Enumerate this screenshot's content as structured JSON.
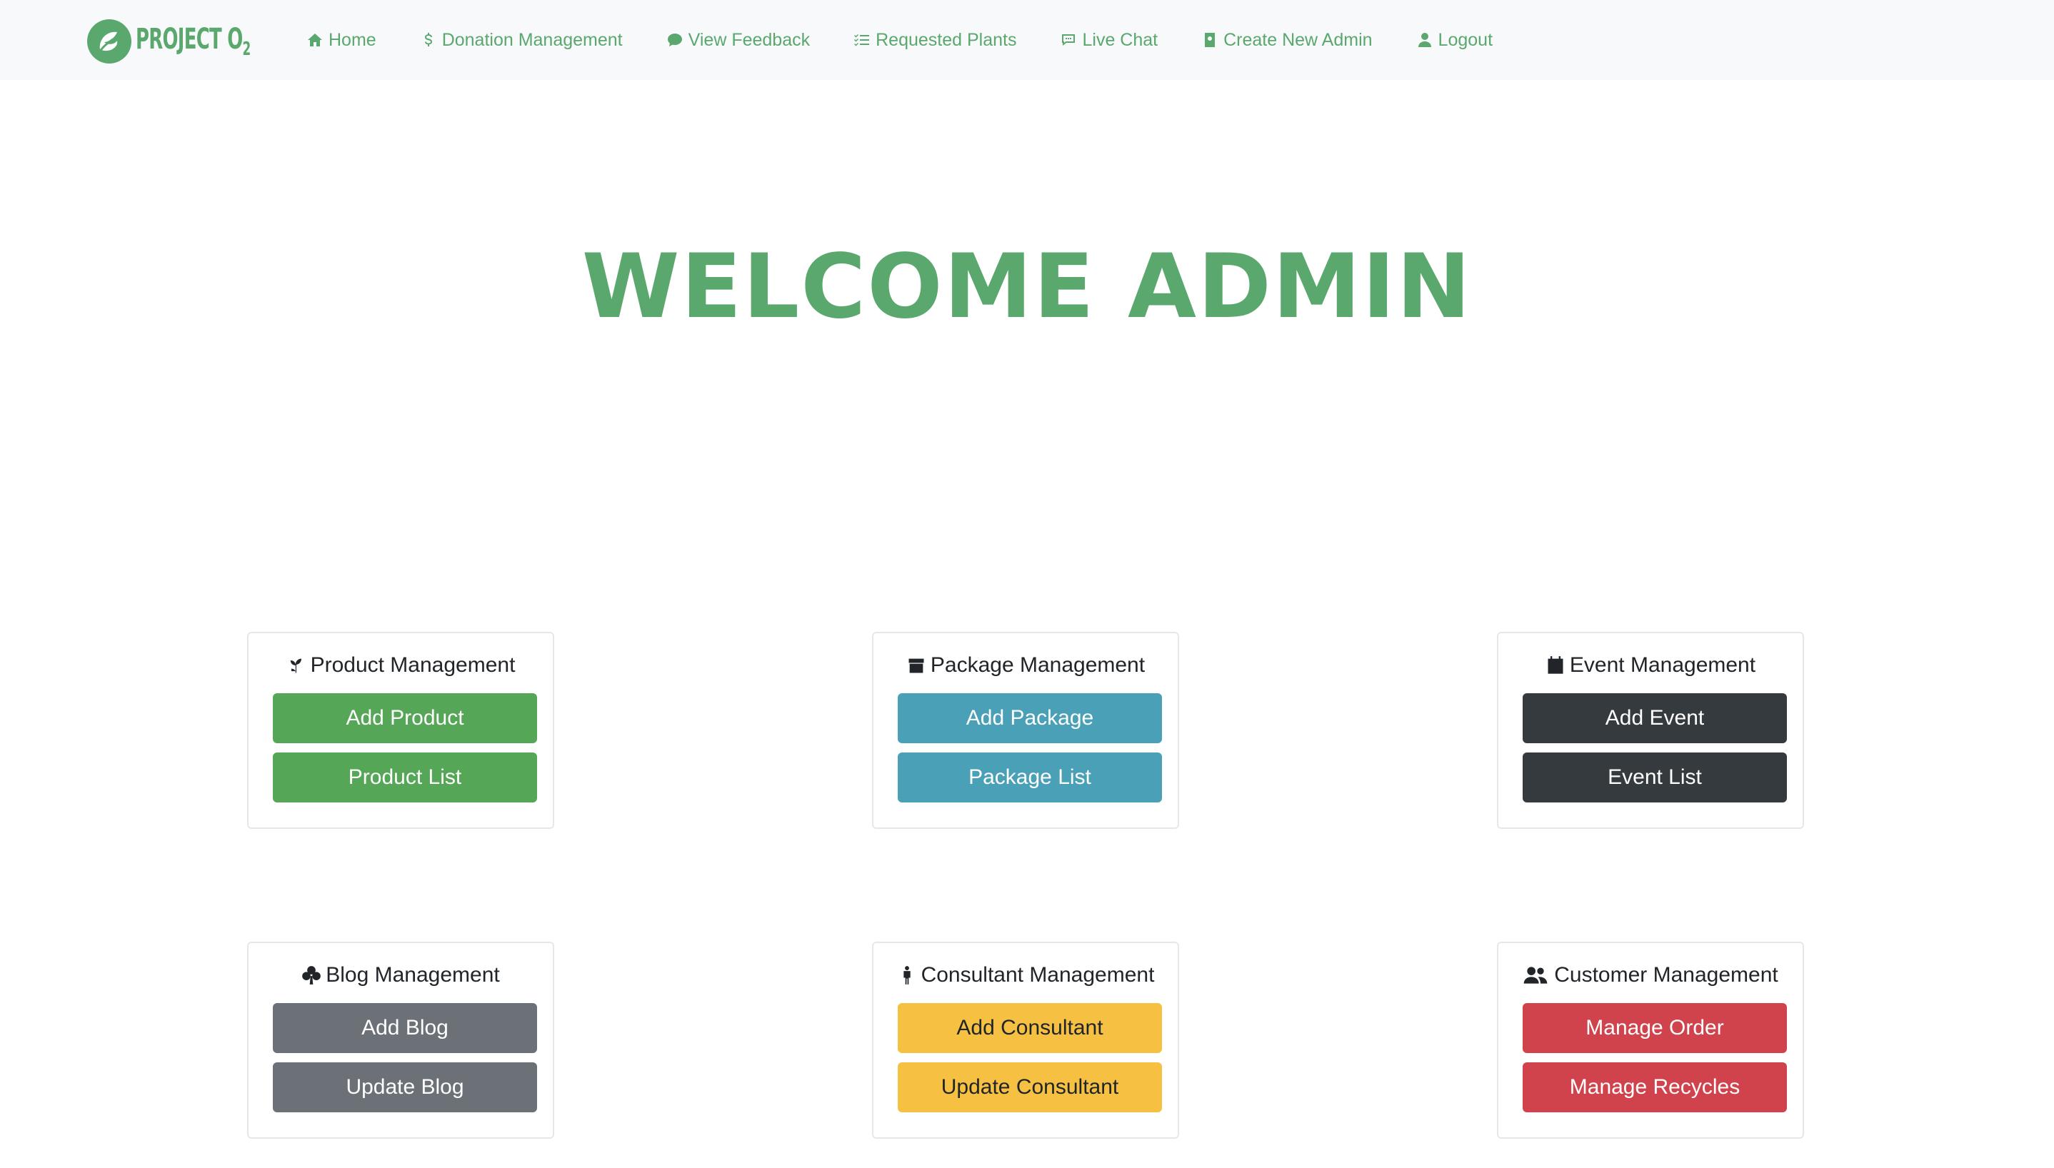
{
  "brand": {
    "name": "PROJECT O",
    "subscript": "2"
  },
  "nav": [
    {
      "label": "Home",
      "icon": "house-icon"
    },
    {
      "label": "Donation Management",
      "icon": "dollar-icon"
    },
    {
      "label": "View Feedback",
      "icon": "chat-bubble-icon"
    },
    {
      "label": "Requested Plants",
      "icon": "checklist-icon"
    },
    {
      "label": "Live Chat",
      "icon": "chat-dots-icon"
    },
    {
      "label": "Create New Admin",
      "icon": "person-badge-icon"
    },
    {
      "label": "Logout",
      "icon": "person-icon"
    }
  ],
  "welcome": "WELCOME ADMIN",
  "cards": [
    {
      "title": "Product Management",
      "icon": "seedling-icon",
      "buttons": [
        "Add Product",
        "Product List"
      ],
      "color": "#55a657"
    },
    {
      "title": "Package Management",
      "icon": "box-icon",
      "buttons": [
        "Add Package",
        "Package List"
      ],
      "color": "#4aa0b6"
    },
    {
      "title": "Event Management",
      "icon": "calendar-icon",
      "buttons": [
        "Add Event",
        "Event List"
      ],
      "color": "#353a3f"
    },
    {
      "title": "Blog Management",
      "icon": "clover-icon",
      "buttons": [
        "Add Blog",
        "Update Blog"
      ],
      "color": "#6c7177"
    },
    {
      "title": "Consultant Management",
      "icon": "person-standing-icon",
      "buttons": [
        "Add Consultant",
        "Update Consultant"
      ],
      "color": "#f6c143"
    },
    {
      "title": "Customer Management",
      "icon": "people-icon",
      "buttons": [
        "Manage Order",
        "Manage Recycles"
      ],
      "color": "#d1434c"
    }
  ]
}
